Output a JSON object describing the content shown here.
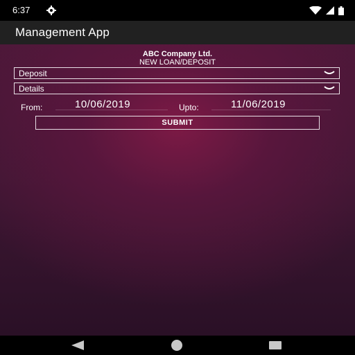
{
  "status_bar": {
    "time": "6:37",
    "icons": [
      "gear-icon",
      "wifi-icon",
      "signal-icon",
      "battery-icon"
    ]
  },
  "app_bar": {
    "title": "Management App"
  },
  "form": {
    "company": "ABC Company Ltd.",
    "subtitle": "NEW LOAN/DEPOSIT",
    "type_select": {
      "selected": "Deposit"
    },
    "view_select": {
      "selected": "Details"
    },
    "from_label": "From:",
    "from_value": "10/06/2019",
    "upto_label": "Upto:",
    "upto_value": "11/06/2019",
    "submit_label": "SUBMIT"
  },
  "nav_bar": {
    "icons": [
      "back-icon",
      "home-icon",
      "recents-icon"
    ]
  },
  "colors": {
    "background_top": "#4a1838",
    "background_glow": "#871a48",
    "app_bar": "#212121",
    "status_bar": "#000000",
    "text": "#ffffff"
  }
}
